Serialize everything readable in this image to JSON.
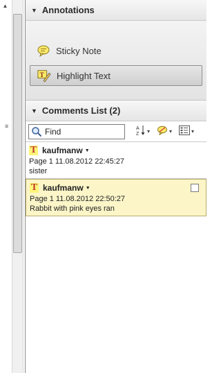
{
  "annotations": {
    "header": "Annotations",
    "tools": [
      {
        "label": "Sticky Note",
        "icon": "sticky-note-icon"
      },
      {
        "label": "Highlight Text",
        "icon": "highlight-text-icon"
      }
    ]
  },
  "comments_list": {
    "header": "Comments List (2)",
    "find_label": "Find",
    "items": [
      {
        "author": "kaufmanw",
        "meta": "Page 1  11.08.2012 22:45:27",
        "text": "sister",
        "selected": false
      },
      {
        "author": "kaufmanw",
        "meta": "Page 1  11.08.2012 22:50:27",
        "text": "Rabbit with pink eyes ran",
        "selected": true
      }
    ]
  },
  "colors": {
    "selected_bg": "#fbf5c8",
    "badge_bg": "#fff57a",
    "badge_fg": "#c0392b"
  }
}
